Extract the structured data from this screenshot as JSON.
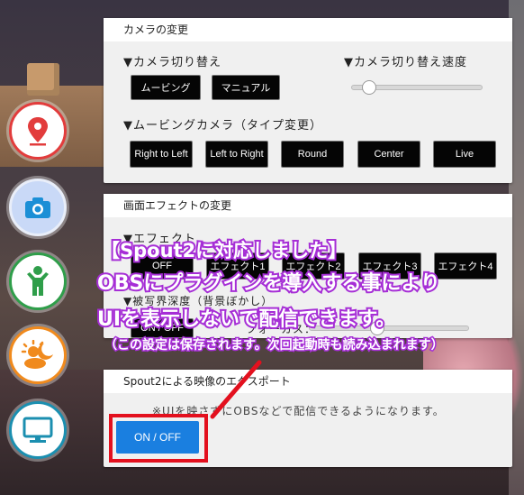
{
  "camera_panel": {
    "title": "カメラの変更",
    "switch_label": "▼カメラ切り替え",
    "speed_label": "▼カメラ切り替え速度",
    "buttons": [
      "ムービング",
      "マニュアル"
    ],
    "speed_level": 0.1,
    "moving_label": "▼ムービングカメラ（タイプ変更）",
    "moving_buttons": [
      "Right to Left",
      "Left to Right",
      "Round",
      "Center",
      "Live"
    ]
  },
  "effect_panel": {
    "title": "画面エフェクトの変更",
    "effect_label": "▼エフェクト",
    "effect_buttons": [
      "OFF",
      "エフェクト1",
      "エフェクト2",
      "エフェクト3",
      "エフェクト4"
    ],
    "dof_label": "▼被写界深度（背景ぼかし）",
    "dof_button": "ON / OFF",
    "focus_label": "フォーカス：",
    "focus_level": 0.4
  },
  "spout_panel": {
    "title": "Spout2による映像のエクスポート",
    "note": "※UIを映さずにOBSなどで配信できるようになります。",
    "button": "ON / OFF"
  },
  "overlay": {
    "line1": "【Spout2に対応しました】",
    "line2": "OBSにプラグインを導入する事により",
    "line3": "UIを表示しないで配信できます。",
    "line4": "（この設定は保存されます。次回起動時も読み込まれます）",
    "stroke_color": "#a62ed6",
    "highlight_color": "#e3101e"
  },
  "side_menu": {
    "icons": [
      "location-pin-icon",
      "camera-icon",
      "person-icon",
      "sun-moon-icon",
      "monitor-icon"
    ],
    "colors": [
      "#e23c3c",
      "#1b8fd6",
      "#2f9e4a",
      "#f08a1d",
      "#1b8fb0"
    ]
  }
}
